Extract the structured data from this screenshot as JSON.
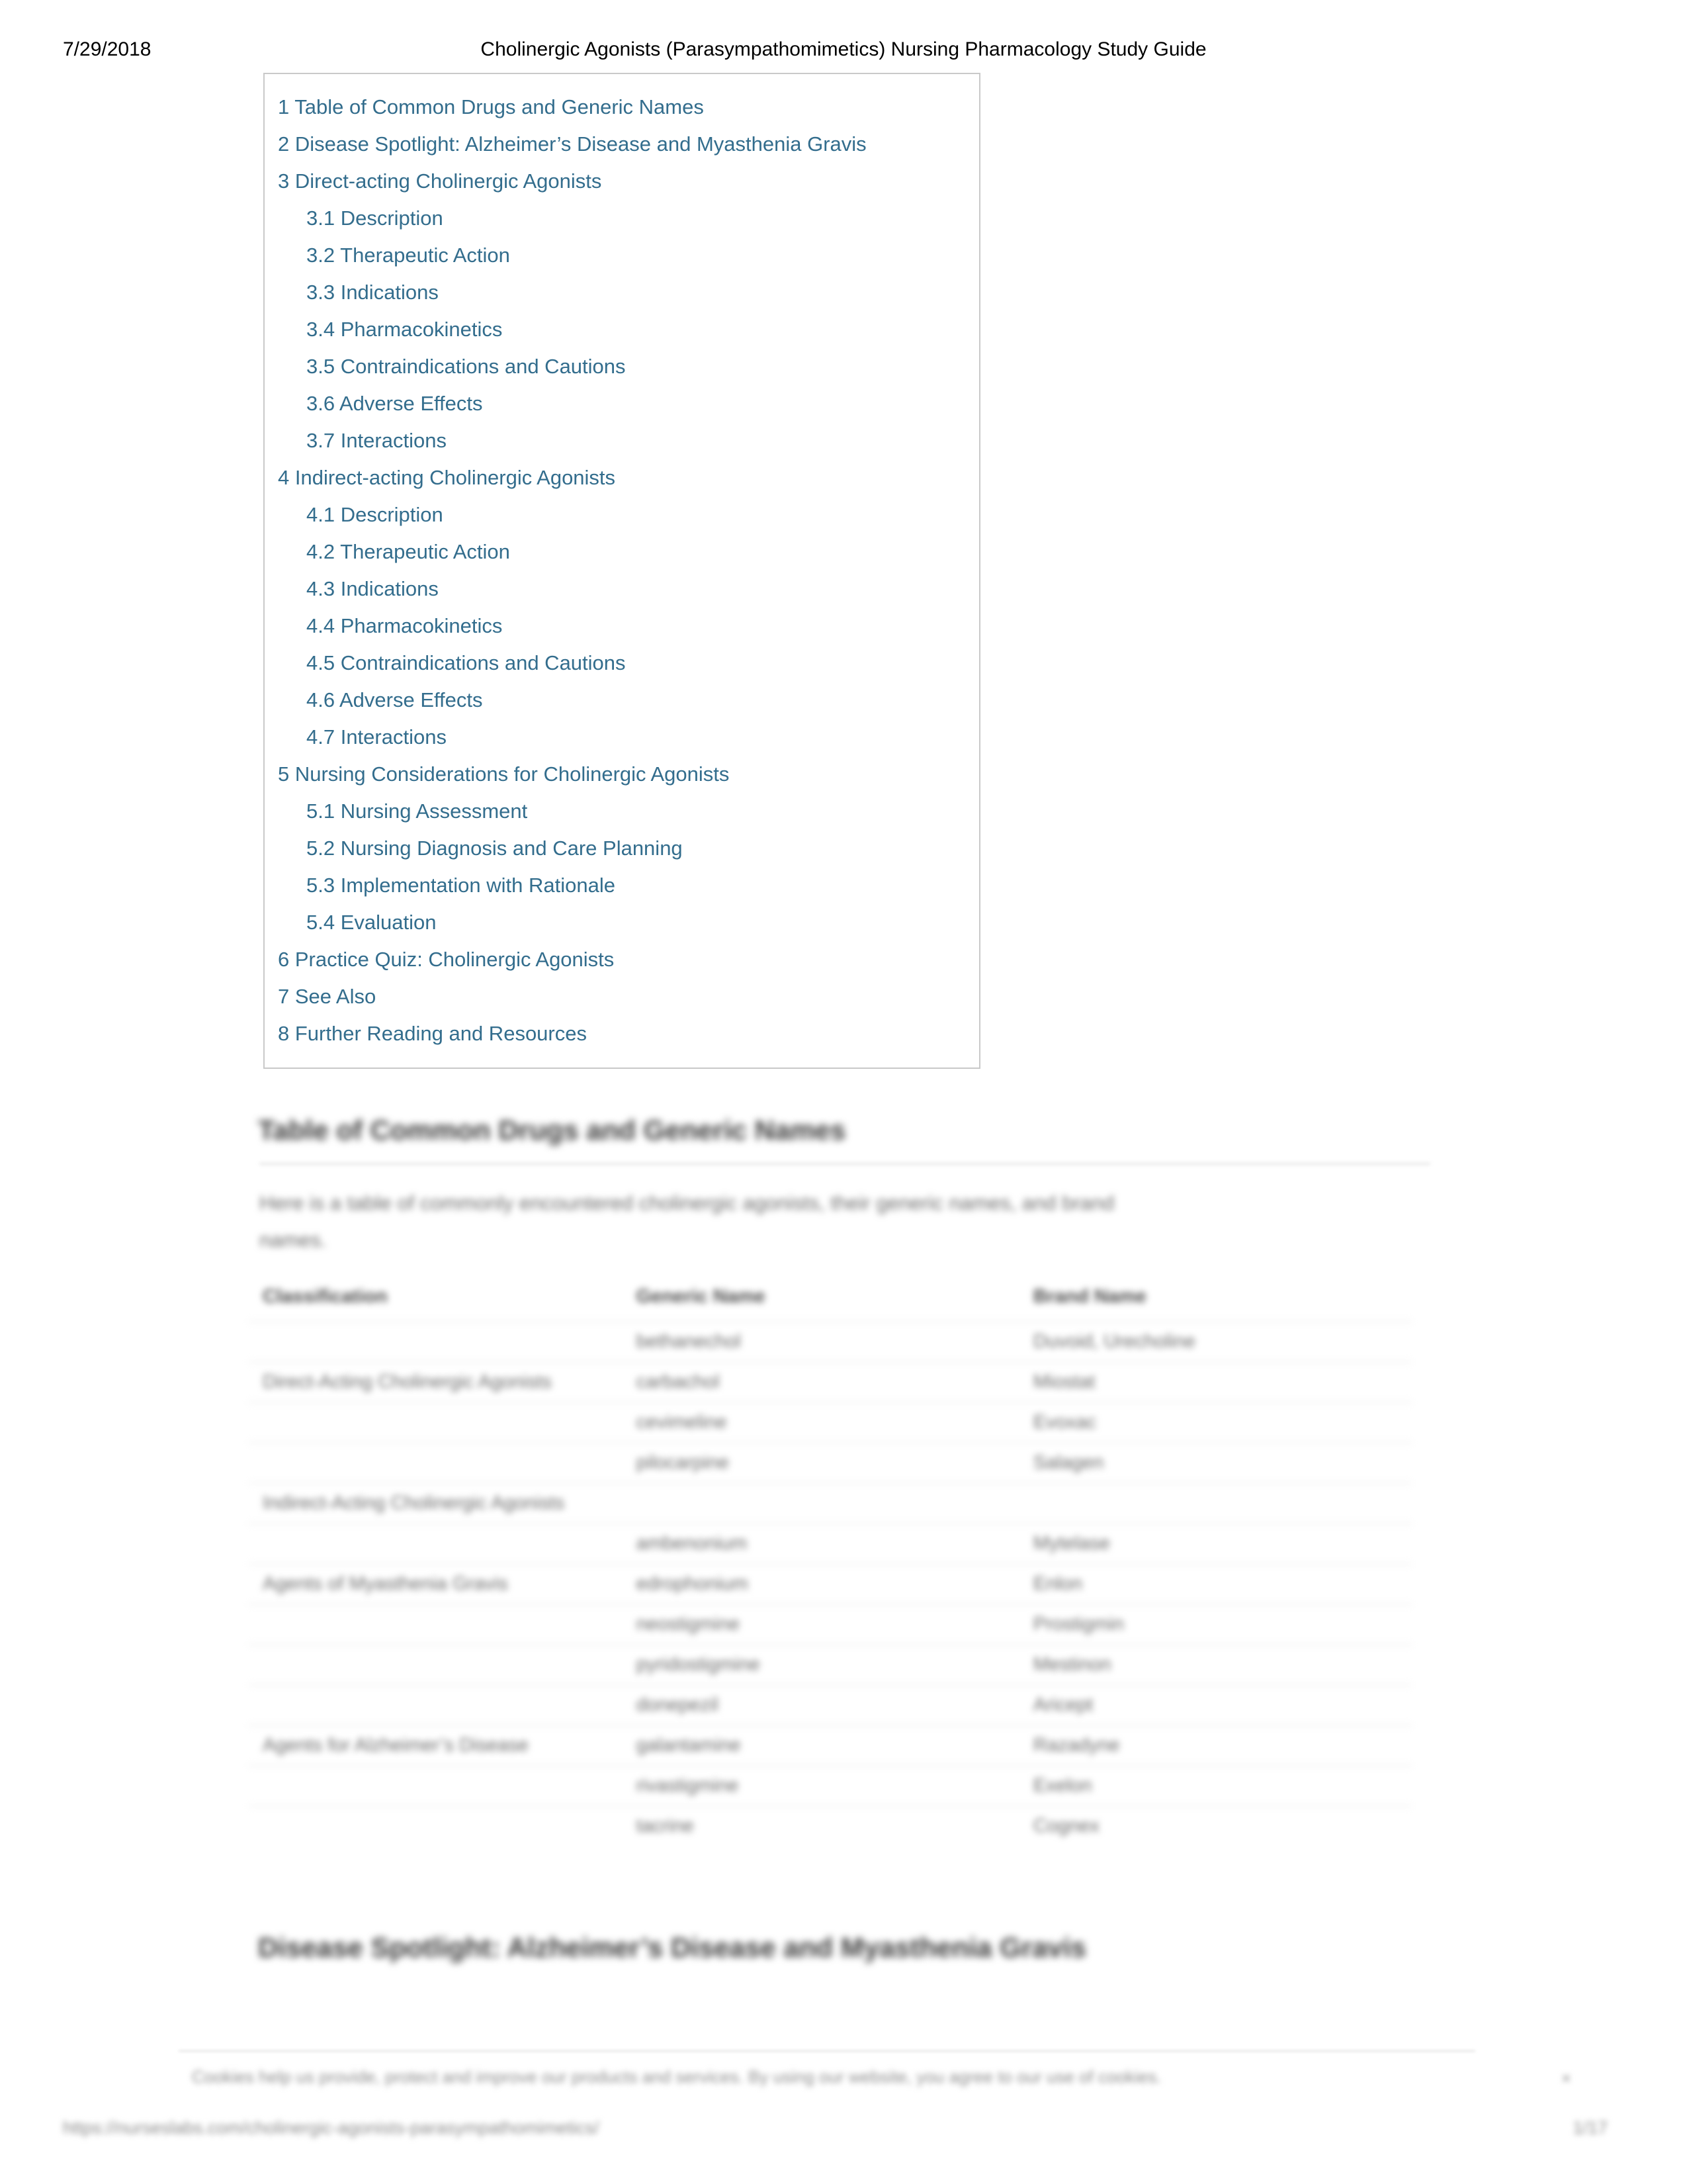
{
  "print_header": {
    "date": "7/29/2018",
    "title": "Cholinergic Agonists (Parasympathomimetics) Nursing Pharmacology Study Guide"
  },
  "toc": {
    "items": [
      {
        "number": "1",
        "label": "1 Table of Common Drugs and Generic Names",
        "level": 1
      },
      {
        "number": "2",
        "label": "2 Disease Spotlight: Alzheimer’s Disease and Myasthenia Gravis",
        "level": 1
      },
      {
        "number": "3",
        "label": "3 Direct-acting Cholinergic Agonists",
        "level": 1
      },
      {
        "number": "3.1",
        "label": "3.1 Description",
        "level": 2
      },
      {
        "number": "3.2",
        "label": "3.2 Therapeutic Action",
        "level": 2
      },
      {
        "number": "3.3",
        "label": "3.3 Indications",
        "level": 2
      },
      {
        "number": "3.4",
        "label": "3.4 Pharmacokinetics",
        "level": 2
      },
      {
        "number": "3.5",
        "label": "3.5 Contraindications and Cautions",
        "level": 2
      },
      {
        "number": "3.6",
        "label": "3.6 Adverse Effects",
        "level": 2
      },
      {
        "number": "3.7",
        "label": "3.7 Interactions",
        "level": 2
      },
      {
        "number": "4",
        "label": "4 Indirect-acting Cholinergic Agonists",
        "level": 1
      },
      {
        "number": "4.1",
        "label": "4.1 Description",
        "level": 2
      },
      {
        "number": "4.2",
        "label": "4.2 Therapeutic Action",
        "level": 2
      },
      {
        "number": "4.3",
        "label": "4.3 Indications",
        "level": 2
      },
      {
        "number": "4.4",
        "label": "4.4 Pharmacokinetics",
        "level": 2
      },
      {
        "number": "4.5",
        "label": "4.5 Contraindications and Cautions",
        "level": 2
      },
      {
        "number": "4.6",
        "label": "4.6 Adverse Effects",
        "level": 2
      },
      {
        "number": "4.7",
        "label": "4.7 Interactions",
        "level": 2
      },
      {
        "number": "5",
        "label": "5 Nursing Considerations for Cholinergic Agonists",
        "level": 1
      },
      {
        "number": "5.1",
        "label": "5.1 Nursing Assessment",
        "level": 2
      },
      {
        "number": "5.2",
        "label": "5.2 Nursing Diagnosis and Care Planning",
        "level": 2
      },
      {
        "number": "5.3",
        "label": "5.3 Implementation with Rationale",
        "level": 2
      },
      {
        "number": "5.4",
        "label": "5.4 Evaluation",
        "level": 2
      },
      {
        "number": "6",
        "label": "6 Practice Quiz: Cholinergic Agonists",
        "level": 1
      },
      {
        "number": "7",
        "label": "7 See Also",
        "level": 1
      },
      {
        "number": "8",
        "label": "8 Further Reading and Resources",
        "level": 1
      }
    ]
  },
  "body": {
    "section_1_heading": "Table of Common Drugs and Generic Names",
    "section_1_intro_line1": "Here is a table of commonly encountered cholinergic agonists, their generic names, and brand",
    "section_1_intro_line2": "names.",
    "section_2_heading": "Disease Spotlight: Alzheimer’s Disease and Myasthenia Gravis"
  },
  "drug_table": {
    "headers": [
      "Classification",
      "Generic Name",
      "Brand Name"
    ],
    "rows": [
      {
        "classification": "",
        "generic": "bethanechol",
        "brand": "Duvoid, Urecholine"
      },
      {
        "classification": "Direct-Acting Cholinergic Agonists",
        "generic": "carbachol",
        "brand": "Miostat"
      },
      {
        "classification": "",
        "generic": "cevimeline",
        "brand": "Evoxac"
      },
      {
        "classification": "",
        "generic": "pilocarpine",
        "brand": "Salagen"
      },
      {
        "classification": "Indirect-Acting Cholinergic Agonists",
        "generic": "",
        "brand": ""
      },
      {
        "classification": "",
        "generic": "ambenonium",
        "brand": "Mytelase"
      },
      {
        "classification": "Agents of Myasthenia Gravis",
        "generic": "edrophonium",
        "brand": "Enlon"
      },
      {
        "classification": "",
        "generic": "neostigmine",
        "brand": "Prostigmin"
      },
      {
        "classification": "",
        "generic": "pyridostigmine",
        "brand": "Mestinon"
      },
      {
        "classification": "",
        "generic": "donepezil",
        "brand": "Aricept"
      },
      {
        "classification": "Agents for Alzheimer’s Disease",
        "generic": "galantamine",
        "brand": "Razadyne"
      },
      {
        "classification": "",
        "generic": "rivastigmine",
        "brand": "Exelon"
      },
      {
        "classification": "",
        "generic": "tacrine",
        "brand": "Cognex"
      }
    ]
  },
  "footer": {
    "cookie_note": "Cookies help us provide, protect and improve our products and services. By using our website, you agree to our use of cookies.",
    "url": "https://nurseslabs.com/cholinergic-agonists-parasympathomimetics/",
    "page_number": "1/17",
    "tick": "×"
  }
}
